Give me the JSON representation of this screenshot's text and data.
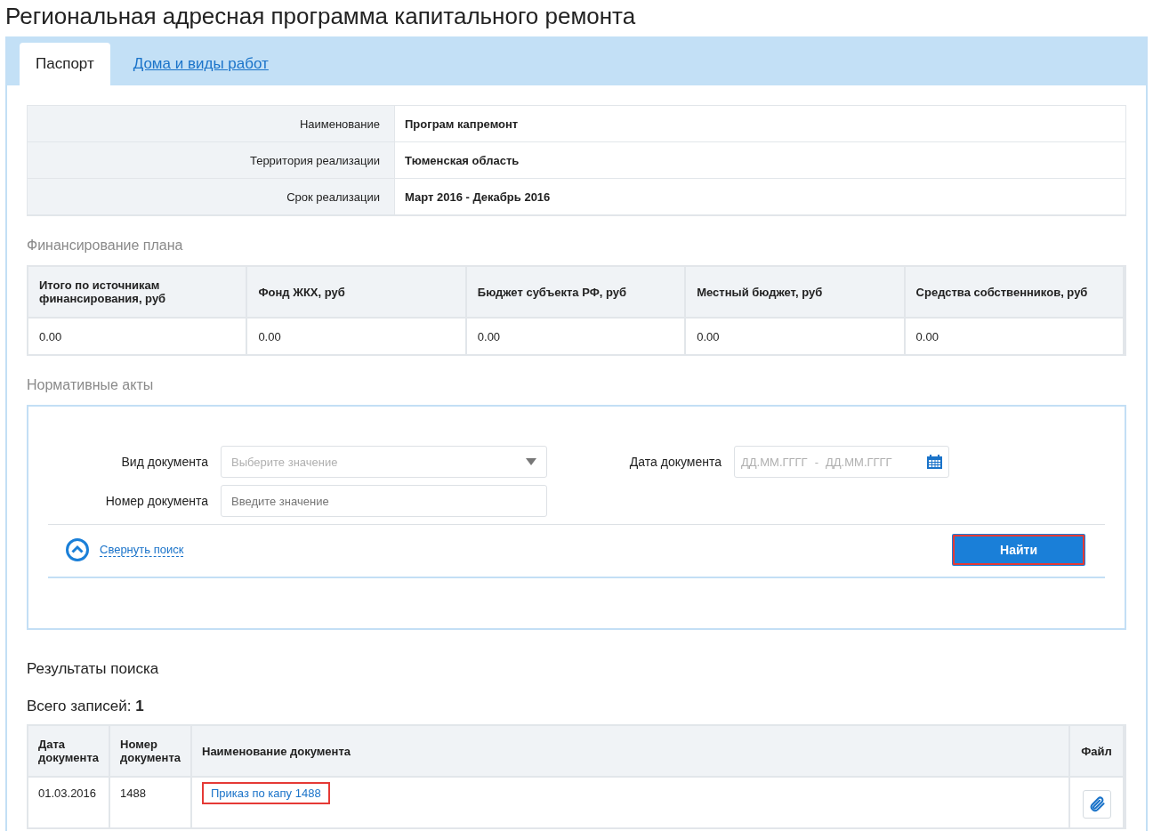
{
  "title": "Региональная адресная программа капитального ремонта",
  "tabs": [
    {
      "label": "Паспорт",
      "selected": true
    },
    {
      "label": "Дома и виды работ",
      "selected": false
    }
  ],
  "passport": [
    {
      "label": "Наименование",
      "value": "Програм капремонт"
    },
    {
      "label": "Территория реализации",
      "value": "Тюменская область"
    },
    {
      "label": "Срок реализации",
      "value": "Март 2016  - Декабрь 2016"
    }
  ],
  "financing": {
    "heading": "Финансирование плана",
    "columns": [
      "Итого по источникам финансирования, руб",
      "Фонд ЖКХ, руб",
      "Бюджет субъекта РФ, руб",
      "Местный бюджет, руб",
      "Средства собственников, руб"
    ],
    "values": [
      "0.00",
      "0.00",
      "0.00",
      "0.00",
      "0.00"
    ]
  },
  "acts": {
    "heading": "Нормативные акты",
    "doc_type": {
      "label": "Вид документа",
      "placeholder": "Выберите значение"
    },
    "doc_number": {
      "label": "Номер документа",
      "placeholder": "Введите значение"
    },
    "doc_date": {
      "label": "Дата документа",
      "from_placeholder": "ДД.ММ.ГГГГ",
      "separator": "-",
      "to_placeholder": "ДД.ММ.ГГГГ"
    },
    "collapse_link": "Свернуть поиск",
    "find_button": {
      "label": "Найти",
      "highlighted": true
    }
  },
  "results": {
    "heading": "Результаты поиска",
    "total_label": "Всего записей:",
    "total": "1",
    "columns": [
      "Дата документа",
      "Номер документа",
      "Наименование документа",
      "Файл"
    ],
    "rows": [
      {
        "date": "01.03.2016",
        "number": "1488",
        "name": "Приказ по капу 1488",
        "highlighted": true
      }
    ]
  }
}
